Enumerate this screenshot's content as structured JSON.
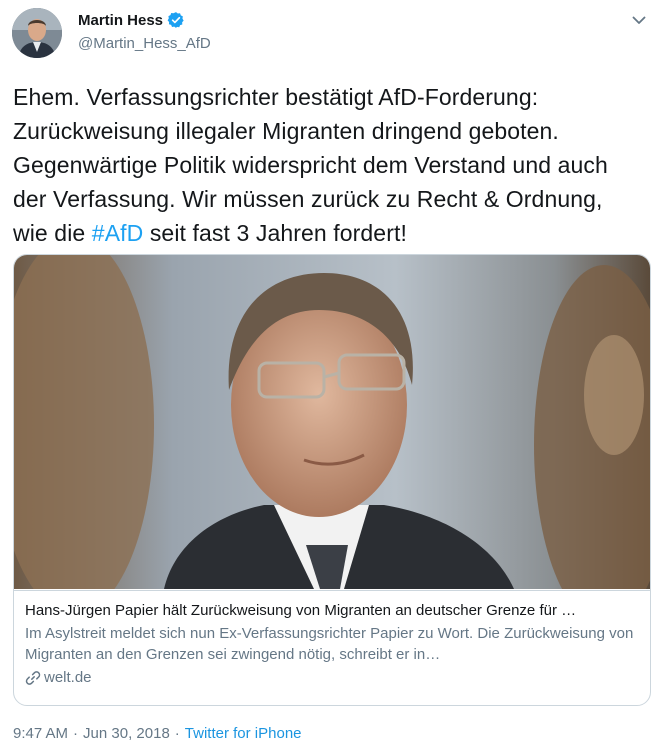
{
  "author": {
    "name": "Martin Hess",
    "handle": "@Martin_Hess_AfD",
    "verified": true
  },
  "tweet": {
    "text_before": "Ehem. Verfassungsrichter bestätigt AfD-Forderung: Zurückweisung illegaler Migranten dringend geboten. Gegenwärtige Politik widerspricht dem Verstand und auch der Verfassung. Wir müssen zurück zu Recht & Ordnung, wie die ",
    "hashtag": "#AfD",
    "text_after": " seit fast 3 Jahren fordert!"
  },
  "card": {
    "title": "Hans-Jürgen Papier hält Zurückweisung von Migranten an deutscher Grenze für …",
    "description": "Im Asylstreit meldet sich nun Ex-Verfassungsrichter Papier zu Wort. Die Zurückweisung von Migranten an den Grenzen sei zwingend nötig, schreibt er in…",
    "domain": "welt.de"
  },
  "meta": {
    "time": "9:47 AM",
    "separator": "·",
    "date": "Jun 30, 2018",
    "source": "Twitter for iPhone"
  },
  "icons": {
    "verified": "verified-badge-icon",
    "caret": "chevron-down-icon",
    "link": "link-icon"
  },
  "colors": {
    "link_blue": "#1da1f2",
    "secondary_text": "#657786",
    "border": "#ccd6dd"
  }
}
